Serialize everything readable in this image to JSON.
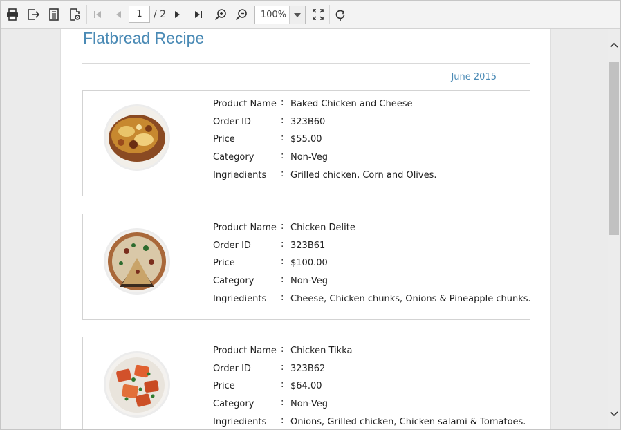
{
  "toolbar": {
    "icons": [
      "print-icon",
      "export-icon",
      "page-setup-icon",
      "print-layout-icon",
      "first-page-icon",
      "previous-page-icon",
      "next-page-icon",
      "last-page-icon",
      "zoom-in-icon",
      "zoom-out-icon",
      "fit-page-icon",
      "refresh-icon"
    ],
    "current_page": "1",
    "total_pages": "/ 2",
    "zoom": "100%"
  },
  "report": {
    "title": "Flatbread Recipe",
    "date": "June 2015",
    "labels": {
      "product_name": "Product Name",
      "order_id": "Order ID",
      "price": "Price",
      "category": "Category",
      "ingredients": "Ingriedients",
      "colon": ":"
    },
    "products": [
      {
        "name": "Baked Chicken and Cheese",
        "order_id": "323B60",
        "price": "$55.00",
        "category": "Non-Veg",
        "ingredients": "Grilled chicken, Corn and Olives.",
        "image": "baked-chicken-cheese-photo"
      },
      {
        "name": "Chicken Delite",
        "order_id": "323B61",
        "price": "$100.00",
        "category": "Non-Veg",
        "ingredients": "Cheese, Chicken chunks, Onions & Pineapple chunks.",
        "image": "chicken-delite-pizza-photo"
      },
      {
        "name": "Chicken Tikka",
        "order_id": "323B62",
        "price": "$64.00",
        "category": "Non-Veg",
        "ingredients": "Onions, Grilled chicken, Chicken salami & Tomatoes.",
        "image": "chicken-tikka-photo"
      }
    ]
  },
  "colors": {
    "accent": "#4a8ab5",
    "toolbar_bg": "#f3f3f3",
    "viewer_bg": "#ebebeb"
  }
}
